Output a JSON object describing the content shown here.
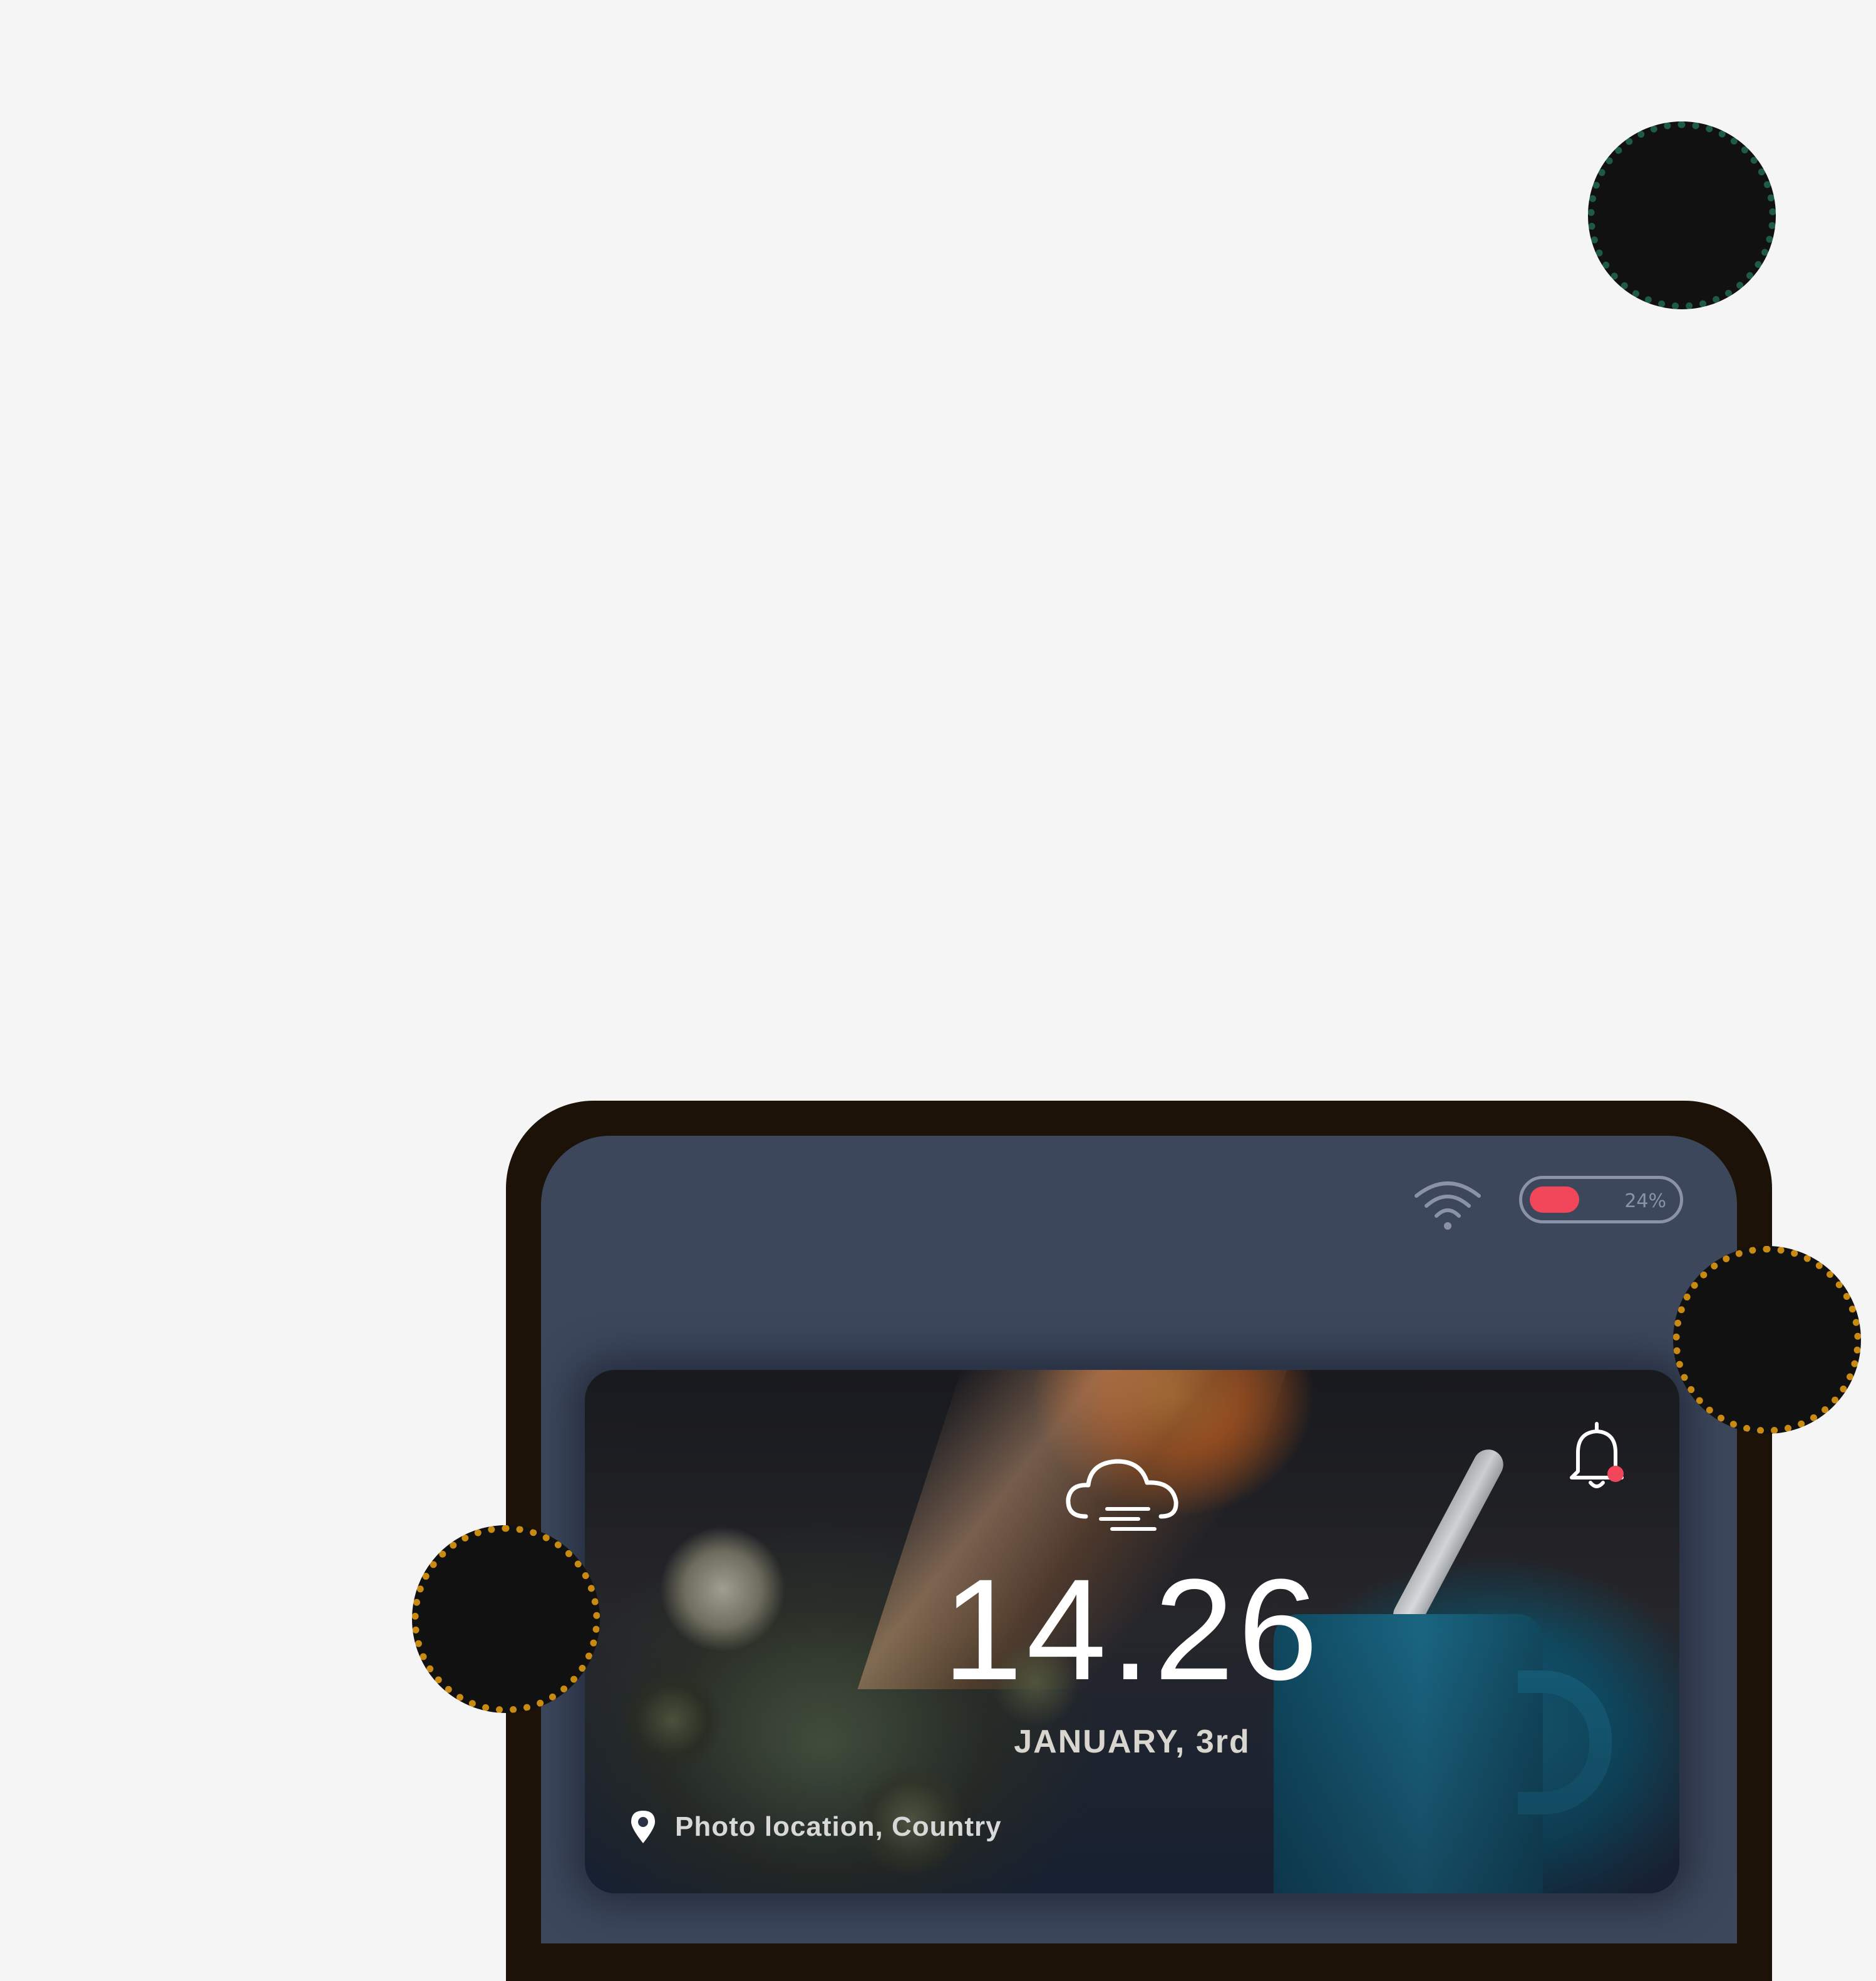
{
  "status_bar": {
    "wifi_icon": "wifi-icon",
    "battery_level_text": "24%",
    "battery_level": 0.24,
    "battery_color": "#f2465a"
  },
  "lock_card": {
    "weather_icon": "cloud-wind-icon",
    "notification_icon": "bell-icon",
    "notification_dot_color": "#f2465a",
    "time": "14.26",
    "date": "JANUARY, 3rd",
    "location_icon": "location-pin-icon",
    "location": "Photo location, Country"
  },
  "decorations": {
    "circle_fill": "#111111",
    "green_border": "#1f5a48",
    "amber_border": "#c98a12"
  },
  "colors": {
    "background": "#f5f5f5",
    "device_frame": "#1d1208",
    "screen": "#3c475b"
  }
}
